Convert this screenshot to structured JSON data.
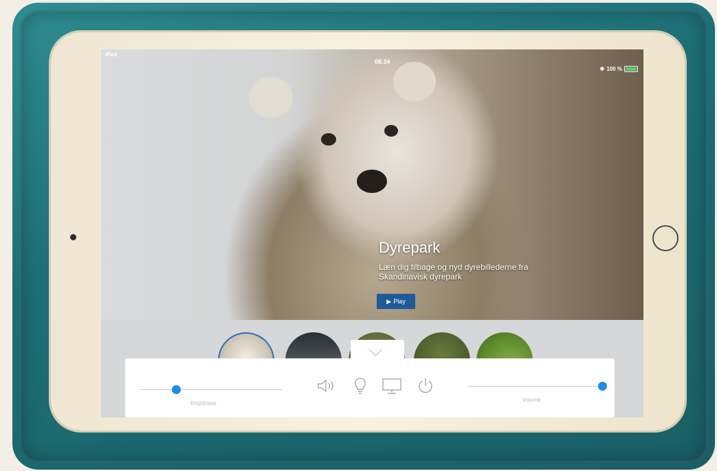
{
  "status_bar": {
    "device": "iPad",
    "time": "08.34",
    "battery": "100 %"
  },
  "hero": {
    "title": "Dyrepark",
    "subtitle": "Læn dig tilbage og nyd dyrebillederne fra Skandinavisk dyrepark",
    "play_label": "Play"
  },
  "thumbnails": [
    {
      "name": "polar-bear",
      "selected": true
    },
    {
      "name": "landscape",
      "selected": false
    },
    {
      "name": "animal-3",
      "selected": false
    },
    {
      "name": "animal-4",
      "selected": false
    },
    {
      "name": "animal-5",
      "selected": false
    }
  ],
  "control_panel": {
    "brightness": {
      "label": "Brightness",
      "value": 0.25
    },
    "volume": {
      "label": "Volume",
      "value": 1.0
    },
    "icons": [
      "speaker-icon",
      "lightbulb-icon",
      "monitor-icon",
      "power-icon"
    ]
  },
  "colors": {
    "accent": "#1f8de6",
    "play_button": "#1c5a9a",
    "case": "#2a8289"
  }
}
